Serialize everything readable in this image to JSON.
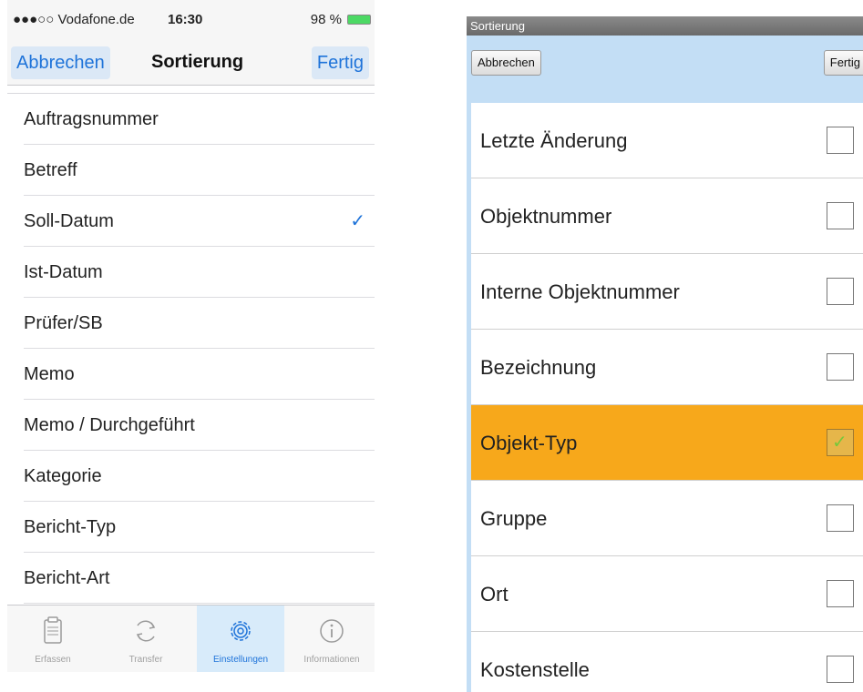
{
  "ios": {
    "status": {
      "carrier": "●●●○○ Vodafone.de",
      "wifi": "wifi-icon",
      "time": "16:30",
      "battery_text": "98 %"
    },
    "nav": {
      "cancel": "Abbrechen",
      "title": "Sortierung",
      "done": "Fertig"
    },
    "items": [
      {
        "label": "Auftragsnummer",
        "checked": false
      },
      {
        "label": "Betreff",
        "checked": false
      },
      {
        "label": "Soll-Datum",
        "checked": true
      },
      {
        "label": "Ist-Datum",
        "checked": false
      },
      {
        "label": "Prüfer/SB",
        "checked": false
      },
      {
        "label": "Memo",
        "checked": false
      },
      {
        "label": "Memo / Durchgeführt",
        "checked": false
      },
      {
        "label": "Kategorie",
        "checked": false
      },
      {
        "label": "Bericht-Typ",
        "checked": false
      },
      {
        "label": "Bericht-Art",
        "checked": false
      }
    ],
    "check_glyph": "✓",
    "tabs": [
      {
        "label": "Erfassen",
        "icon": "clipboard-icon"
      },
      {
        "label": "Transfer",
        "icon": "sync-icon"
      },
      {
        "label": "Einstellungen",
        "icon": "gear-icon",
        "active": true
      },
      {
        "label": "Informationen",
        "icon": "info-icon"
      }
    ],
    "accent": "#1e73d9"
  },
  "android": {
    "title": "Sortierung",
    "cancel": "Abbrechen",
    "done": "Fertig",
    "items": [
      {
        "label": "Letzte Änderung",
        "checked": false
      },
      {
        "label": "Objektnummer",
        "checked": false
      },
      {
        "label": "Interne Objektnummer",
        "checked": false
      },
      {
        "label": "Bezeichnung",
        "checked": false
      },
      {
        "label": "Objekt-Typ",
        "checked": true
      },
      {
        "label": "Gruppe",
        "checked": false
      },
      {
        "label": "Ort",
        "checked": false
      },
      {
        "label": "Kostenstelle",
        "checked": false
      }
    ],
    "tick_glyph": "✓",
    "selected_color": "#f7a81b"
  }
}
